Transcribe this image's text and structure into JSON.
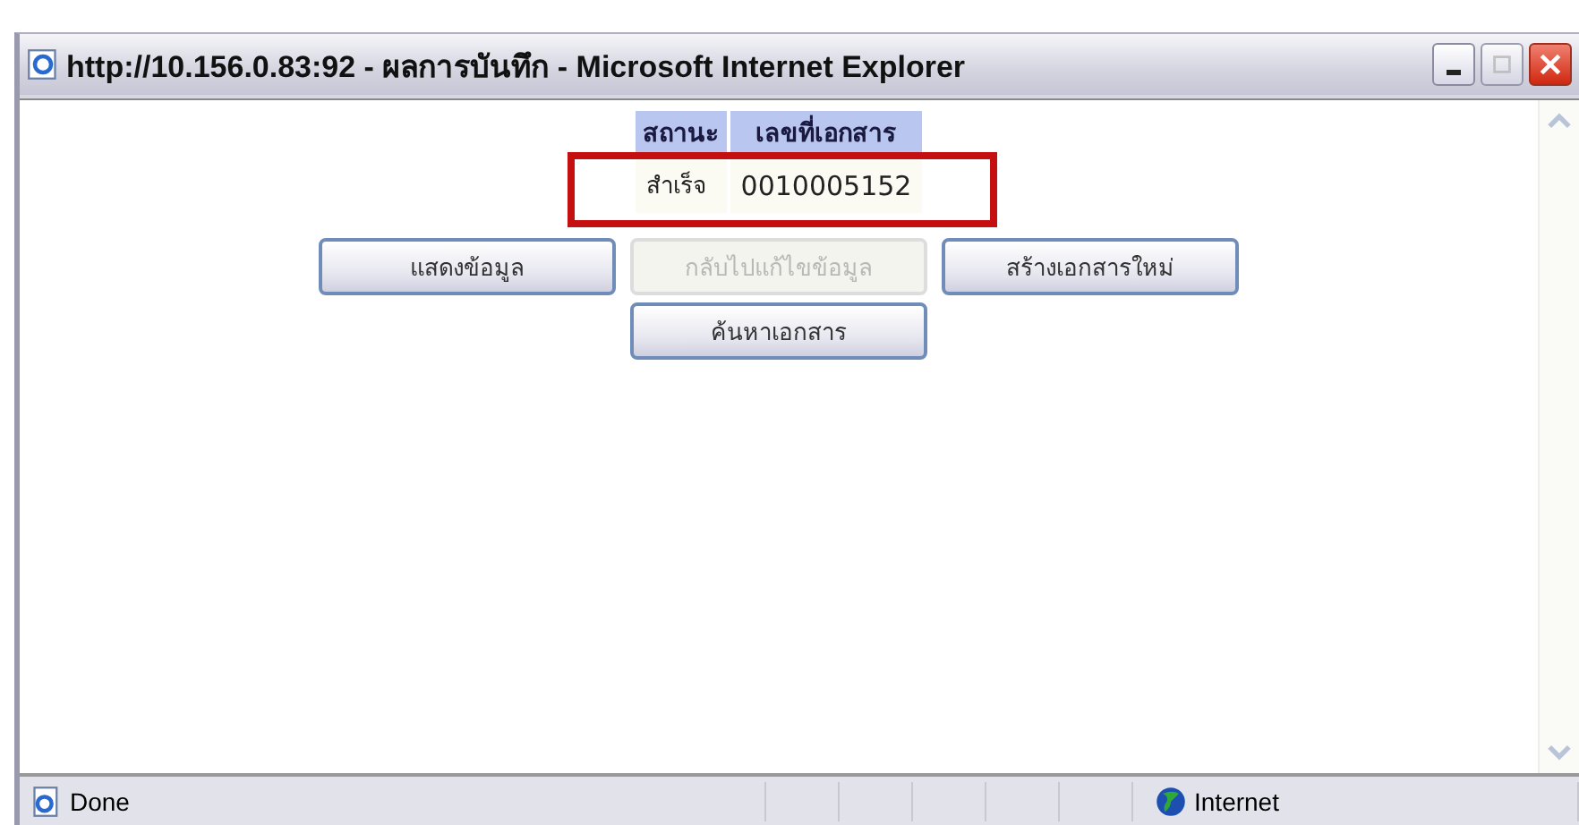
{
  "window": {
    "title": "http://10.156.0.83:92 - ผลการบันทึก - Microsoft Internet Explorer"
  },
  "table": {
    "columns": [
      "สถานะ",
      "เลขที่เอกสาร"
    ],
    "rows": [
      {
        "cells": [
          "สำเร็จ",
          "0010005152"
        ],
        "highlighted": true
      }
    ]
  },
  "buttons": [
    {
      "label": "แสดงข้อมูล",
      "disabled": false
    },
    {
      "label": "กลับไปแก้ไขข้อมูล",
      "disabled": true
    },
    {
      "label": "สร้างเอกสารใหม่",
      "disabled": false
    },
    {
      "label": "ค้นหาเอกสาร",
      "disabled": false
    }
  ],
  "status_bar": {
    "text": "Done",
    "zone": "Internet"
  }
}
